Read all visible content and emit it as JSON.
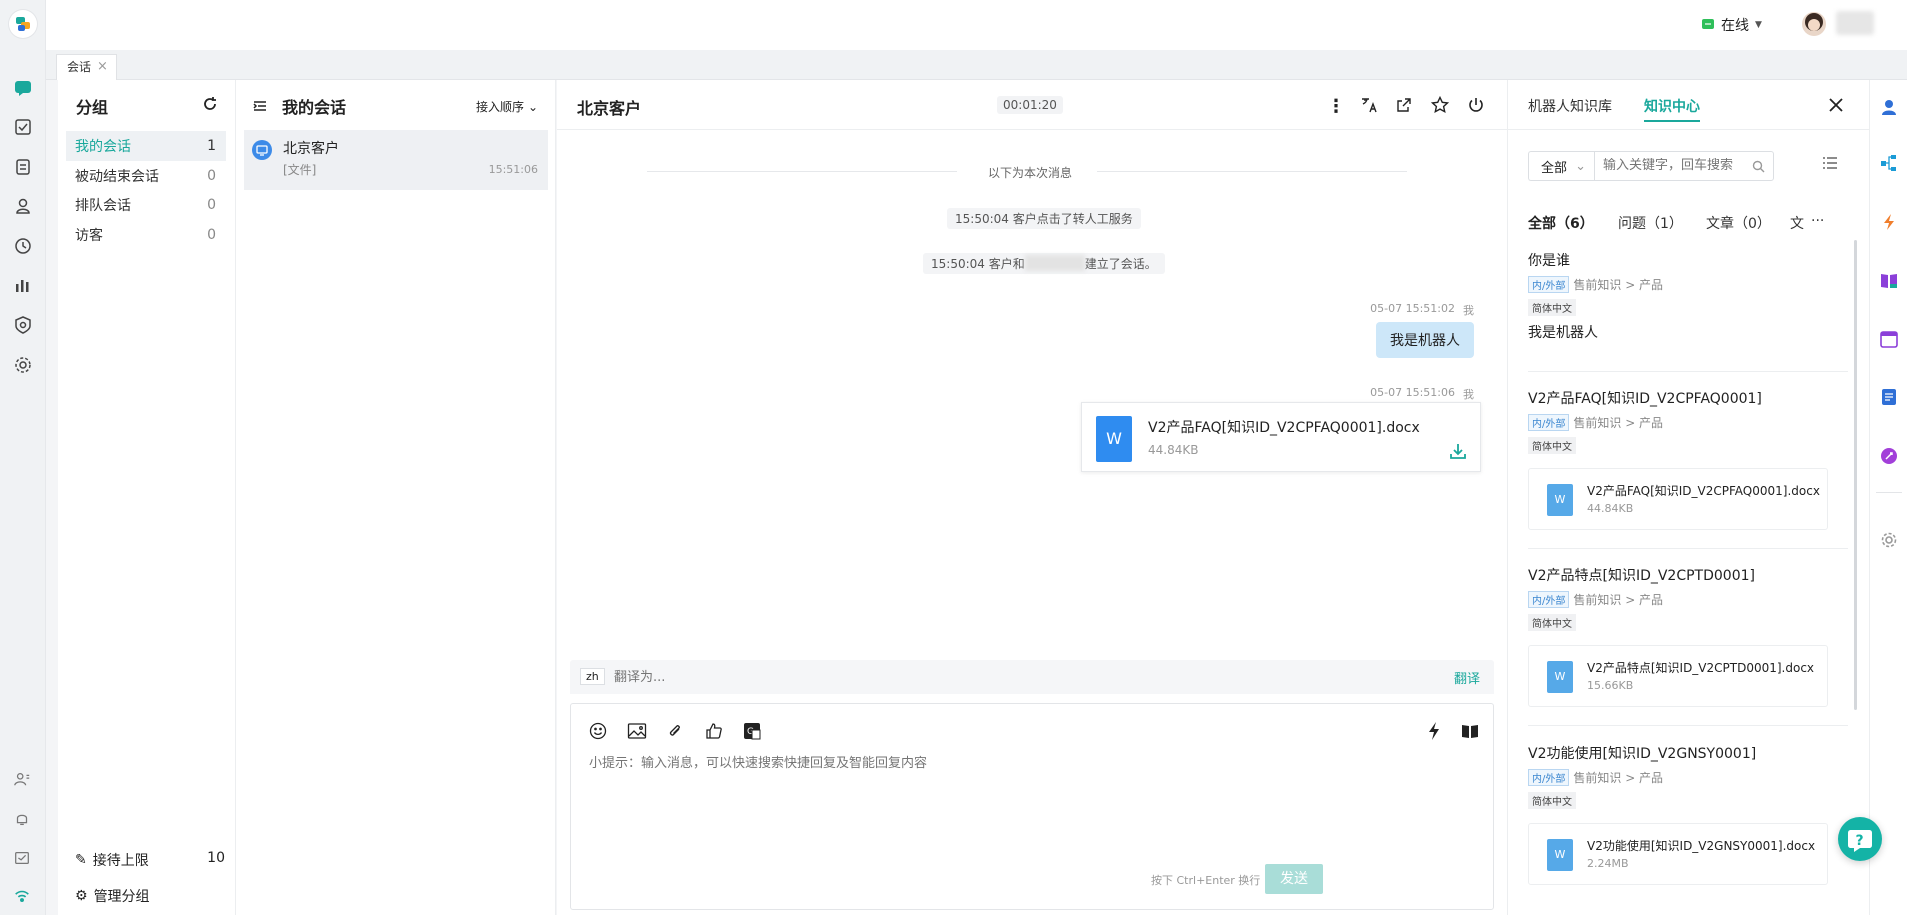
{
  "topbar": {
    "status": "在线"
  },
  "tabs": [
    {
      "label": "会话",
      "close": "×"
    }
  ],
  "groups": {
    "title": "分组",
    "items": [
      {
        "label": "我的会话",
        "count": "1"
      },
      {
        "label": "被动结束会话",
        "count": "0"
      },
      {
        "label": "排队会话",
        "count": "0"
      },
      {
        "label": "访客",
        "count": "0"
      }
    ],
    "limit_label": "接待上限",
    "limit_value": "10",
    "manage_label": "管理分组"
  },
  "conversations": {
    "title": "我的会话",
    "sort_label": "接入顺序",
    "items": [
      {
        "name": "北京客户",
        "preview": "[文件]",
        "time": "15:51:06"
      }
    ]
  },
  "chat": {
    "title": "北京客户",
    "timer": "00:01:20",
    "divider": "以下为本次消息",
    "system": [
      "15:50:04 客户点击了转人工服务",
      "15:50:04 客户和",
      "建立了会话。"
    ],
    "messages": [
      {
        "meta": "05-07 15:51:02",
        "sender": "我",
        "text": "我是机器人"
      },
      {
        "meta": "05-07 15:51:06",
        "sender": "我",
        "file_name": "V2产品FAQ[知识ID_V2CPFAQ0001].docx",
        "file_size": "44.84KB",
        "file_icon": "W"
      }
    ],
    "translate": {
      "lang": "zh",
      "placeholder": "翻译为...",
      "button": "翻译"
    },
    "input_placeholder": "小提示：输入消息，可以快速搜索快捷回复及智能回复内容",
    "send_hint": "按下 Ctrl+Enter 换行",
    "send_label": "发送"
  },
  "knowledge": {
    "tabs": [
      "机器人知识库",
      "知识中心"
    ],
    "active_tab": 1,
    "filter_value": "全部",
    "search_placeholder": "输入关键字，回车搜索",
    "categories": [
      "全部（6）",
      "问题（1）",
      "文章（0）",
      "文"
    ],
    "more": "···",
    "items": [
      {
        "title": "你是谁",
        "tag": "内/外部",
        "path": "售前知识 > 产品",
        "lang": "简体中文",
        "answer": "我是机器人"
      },
      {
        "title": "V2产品FAQ[知识ID_V2CPFAQ0001]",
        "tag": "内/外部",
        "path": "售前知识 > 产品",
        "lang": "简体中文",
        "file_name": "V2产品FAQ[知识ID_V2CPFAQ0001].docx",
        "file_size": "44.84KB"
      },
      {
        "title": "V2产品特点[知识ID_V2CPTD0001]",
        "tag": "内/外部",
        "path": "售前知识 > 产品",
        "lang": "简体中文",
        "file_name": "V2产品特点[知识ID_V2CPTD0001].docx",
        "file_size": "15.66KB"
      },
      {
        "title": "V2功能使用[知识ID_V2GNSY0001]",
        "tag": "内/外部",
        "path": "售前知识 > 产品",
        "lang": "简体中文",
        "file_name": "V2功能使用[知识ID_V2GNSY0001].docx",
        "file_size": "2.24MB"
      }
    ]
  },
  "colors": {
    "accent": "#1aa89c",
    "bubble": "#cde7f9",
    "send_disabled": "#a9ddd8",
    "file_blue": "#2f8cf0"
  }
}
